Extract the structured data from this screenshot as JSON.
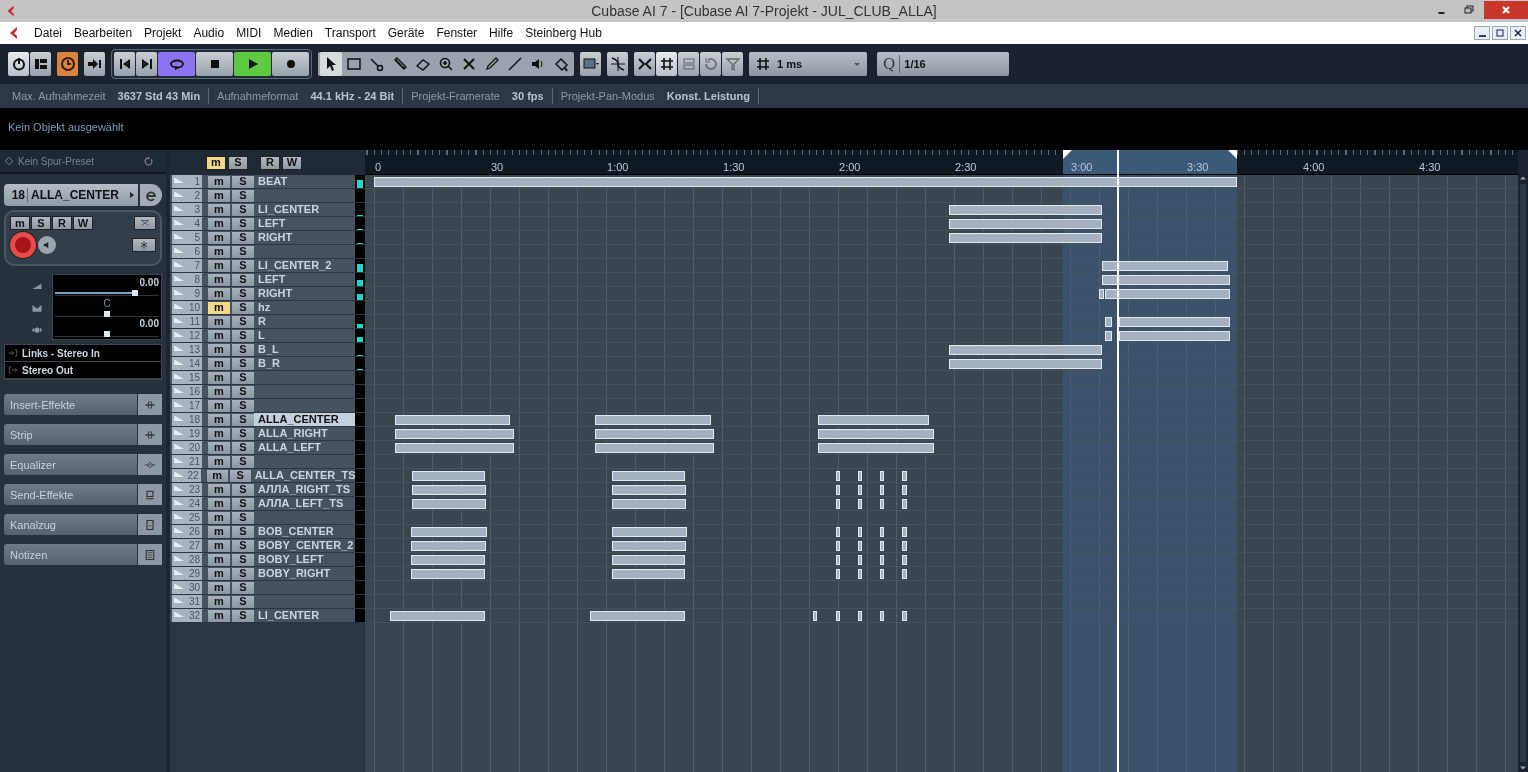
{
  "window": {
    "title": "Cubase AI 7 - [Cubase AI 7-Projekt - JUL_CLUB_ALLA]"
  },
  "menu": [
    "Datei",
    "Bearbeiten",
    "Projekt",
    "Audio",
    "MIDI",
    "Medien",
    "Transport",
    "Geräte",
    "Fenster",
    "Hilfe",
    "Steinberg Hub"
  ],
  "toolbar": {
    "groups": [
      {
        "kind": "plain",
        "items": [
          {
            "kind": "power",
            "on": true
          },
          {
            "kind": "layout",
            "on": false
          }
        ]
      },
      {
        "kind": "plain",
        "items": [
          {
            "kind": "constrain",
            "on": true
          }
        ]
      },
      {
        "kind": "plain",
        "items": [
          {
            "kind": "automation",
            "on": false
          }
        ]
      },
      {
        "kind": "transport",
        "items": [
          {
            "kind": "prev",
            "on": false
          },
          {
            "kind": "next",
            "on": false
          },
          {
            "kind": "cycle",
            "on": true
          },
          {
            "kind": "stop",
            "on": false
          },
          {
            "kind": "play",
            "on": true
          },
          {
            "kind": "record",
            "on": false
          }
        ]
      },
      {
        "kind": "tools",
        "items": [
          {
            "kind": "arrow",
            "selected": true
          },
          {
            "kind": "range",
            "selected": false
          },
          {
            "kind": "split",
            "selected": false
          },
          {
            "kind": "glue",
            "selected": false
          },
          {
            "kind": "erase",
            "selected": false
          },
          {
            "kind": "zoom",
            "selected": false
          },
          {
            "kind": "mute",
            "selected": false
          },
          {
            "kind": "draw",
            "selected": false
          },
          {
            "kind": "line",
            "selected": false
          },
          {
            "kind": "speaker",
            "selected": false
          },
          {
            "kind": "colorize",
            "selected": false
          }
        ]
      },
      {
        "kind": "plain",
        "items": [
          {
            "kind": "color",
            "on": false
          }
        ]
      },
      {
        "kind": "plain",
        "items": [
          {
            "kind": "snapzero",
            "on": false
          }
        ]
      },
      {
        "kind": "plain",
        "items": [
          {
            "kind": "snaptype",
            "on": false
          },
          {
            "kind": "grid",
            "on": true
          },
          {
            "kind": "lanes",
            "on": false
          },
          {
            "kind": "loop",
            "on": false
          },
          {
            "kind": "funnel",
            "on": false
          }
        ]
      }
    ],
    "grid_value": "1 ms",
    "quantize_label": "Q",
    "quantize_value": "1/16"
  },
  "info_line": [
    {
      "label": "Max. Aufnahmezeit",
      "value": "3637 Std 43 Min"
    },
    {
      "label": "Aufnahmeformat",
      "value": "44.1 kHz - 24 Bit"
    },
    {
      "label": "Projekt-Framerate",
      "value": "30 fps"
    },
    {
      "label": "Projekt-Pan-Modus",
      "value": "Konst. Leistung"
    }
  ],
  "selection_info": "Kein Objekt ausgewählt",
  "inspector": {
    "preset": "Kein Spur-Preset",
    "track_number": "18",
    "track_name": "ALLA_CENTER",
    "buttons": [
      {
        "label": "m",
        "on": false
      },
      {
        "label": "S",
        "on": false
      },
      {
        "label": "R",
        "on": false
      },
      {
        "label": "W",
        "on": false
      }
    ],
    "record_enabled": true,
    "monitor": false,
    "volume": {
      "level": 0.77,
      "reading": "0.00"
    },
    "pan": {
      "level": 0.5,
      "reading": "C"
    },
    "delay": {
      "level": 0.5,
      "reading": "0.00"
    },
    "input": "Links - Stereo In",
    "output": "Stereo Out",
    "sections": [
      {
        "label": "Insert-Effekte",
        "kind": "insert"
      },
      {
        "label": "Strip",
        "kind": "strip"
      },
      {
        "label": "Equalizer",
        "kind": "eq"
      },
      {
        "label": "Send-Effekte",
        "kind": "send"
      },
      {
        "label": "Kanalzug",
        "kind": "channel"
      },
      {
        "label": "Notizen",
        "kind": "notes"
      }
    ]
  },
  "track_header": [
    {
      "label": "m",
      "on": true
    },
    {
      "label": "S",
      "on": false
    },
    {
      "label": "R",
      "on": false
    },
    {
      "label": "W",
      "on": false
    }
  ],
  "ruler": [
    "0",
    "30",
    "1:00",
    "1:30",
    "2:00",
    "2:30",
    "3:00",
    "3:30",
    "4:00",
    "4:30"
  ],
  "tracks": [
    {
      "number": "1",
      "mute": "m",
      "solo": "S",
      "name": "BEAT",
      "muted": false,
      "selected": false,
      "level": 0.6,
      "events": [
        {
          "kind": "audio"
        }
      ]
    },
    {
      "number": "2",
      "mute": "m",
      "solo": "S",
      "muted": false,
      "selected": false
    },
    {
      "number": "3",
      "mute": "m",
      "solo": "S",
      "name": "LI_CENTER",
      "muted": false,
      "selected": false,
      "level": 0.1,
      "events": [
        {
          "kind": "audio"
        }
      ]
    },
    {
      "number": "4",
      "mute": "m",
      "solo": "S",
      "name": "LEFT",
      "muted": false,
      "selected": false,
      "level": 0.1,
      "events": [
        {
          "kind": "audio"
        }
      ]
    },
    {
      "number": "5",
      "mute": "m",
      "solo": "S",
      "name": "RIGHT",
      "muted": false,
      "selected": false,
      "level": 0.1,
      "events": [
        {
          "kind": "audio"
        }
      ]
    },
    {
      "number": "6",
      "mute": "m",
      "solo": "S",
      "muted": false,
      "selected": false
    },
    {
      "number": "7",
      "mute": "m",
      "solo": "S",
      "name": "LI_CENTER_2",
      "muted": false,
      "selected": false,
      "level": 0.6,
      "events": [
        {
          "kind": "audio"
        }
      ]
    },
    {
      "number": "8",
      "mute": "m",
      "solo": "S",
      "name": "LEFT",
      "muted": false,
      "selected": false,
      "level": 0.5,
      "events": [
        {
          "kind": "audio"
        }
      ]
    },
    {
      "number": "9",
      "mute": "m",
      "solo": "S",
      "name": "RIGHT",
      "muted": false,
      "selected": false,
      "level": 0.5,
      "events": [
        {
          "kind": "audio"
        },
        {
          "kind": "audio"
        }
      ]
    },
    {
      "number": "10",
      "mute": "m",
      "solo": "S",
      "name": "hz",
      "muted": true,
      "selected": false
    },
    {
      "number": "11",
      "mute": "m",
      "solo": "S",
      "name": "R",
      "muted": false,
      "selected": false,
      "level": 0.3,
      "events": [
        {
          "kind": "audio"
        },
        {
          "kind": "audio"
        }
      ]
    },
    {
      "number": "12",
      "mute": "m",
      "solo": "S",
      "name": "L",
      "muted": false,
      "selected": false,
      "level": 0.4,
      "events": [
        {
          "kind": "audio"
        },
        {
          "kind": "audio"
        }
      ]
    },
    {
      "number": "13",
      "mute": "m",
      "solo": "S",
      "name": "B_L",
      "muted": false,
      "selected": false,
      "level": 0.05,
      "events": [
        {
          "kind": "audio"
        }
      ]
    },
    {
      "number": "14",
      "mute": "m",
      "solo": "S",
      "name": "B_R",
      "muted": false,
      "selected": false,
      "level": 0.05,
      "events": [
        {
          "kind": "audio"
        }
      ]
    },
    {
      "number": "15",
      "mute": "m",
      "solo": "S",
      "muted": false,
      "selected": false
    },
    {
      "number": "16",
      "mute": "m",
      "solo": "S",
      "muted": false,
      "selected": false
    },
    {
      "number": "17",
      "mute": "m",
      "solo": "S",
      "muted": false,
      "selected": false
    },
    {
      "number": "18",
      "mute": "m",
      "solo": "S",
      "name": "ALLA_CENTER",
      "muted": false,
      "selected": true,
      "events": [
        {
          "kind": "audio"
        },
        {
          "kind": "audio"
        },
        {
          "kind": "audio"
        }
      ]
    },
    {
      "number": "19",
      "mute": "m",
      "solo": "S",
      "name": "ALLA_RIGHT",
      "muted": false,
      "selected": false,
      "events": [
        {
          "kind": "audio"
        },
        {
          "kind": "audio"
        },
        {
          "kind": "audio"
        }
      ]
    },
    {
      "number": "20",
      "mute": "m",
      "solo": "S",
      "name": "ALLA_LEFT",
      "muted": false,
      "selected": false,
      "events": [
        {
          "kind": "audio"
        },
        {
          "kind": "audio"
        },
        {
          "kind": "audio"
        }
      ]
    },
    {
      "number": "21",
      "mute": "m",
      "solo": "S",
      "muted": false,
      "selected": false
    },
    {
      "number": "22",
      "mute": "m",
      "solo": "S",
      "name": "ALLA_CENTER_TS",
      "muted": false,
      "selected": false,
      "events": [
        {
          "kind": "audio"
        },
        {
          "kind": "audio"
        },
        {
          "kind": "audio"
        },
        {
          "kind": "audio"
        },
        {
          "kind": "audio"
        },
        {
          "kind": "audio"
        }
      ]
    },
    {
      "number": "23",
      "mute": "m",
      "solo": "S",
      "name": "АЛЛА_RIGHT_TS",
      "muted": false,
      "selected": false,
      "events": [
        {
          "kind": "audio"
        },
        {
          "kind": "audio"
        },
        {
          "kind": "audio"
        },
        {
          "kind": "audio"
        },
        {
          "kind": "audio"
        },
        {
          "kind": "audio"
        }
      ]
    },
    {
      "number": "24",
      "mute": "m",
      "solo": "S",
      "name": "АЛЛА_LEFT_TS",
      "muted": false,
      "selected": false,
      "events": [
        {
          "kind": "audio"
        },
        {
          "kind": "audio"
        },
        {
          "kind": "audio"
        },
        {
          "kind": "audio"
        },
        {
          "kind": "audio"
        },
        {
          "kind": "audio"
        }
      ]
    },
    {
      "number": "25",
      "mute": "m",
      "solo": "S",
      "muted": false,
      "selected": false
    },
    {
      "number": "26",
      "mute": "m",
      "solo": "S",
      "name": "BOB_CENTER",
      "muted": false,
      "selected": false,
      "events": [
        {
          "kind": "audio"
        },
        {
          "kind": "audio"
        },
        {
          "kind": "audio"
        },
        {
          "kind": "audio"
        },
        {
          "kind": "audio"
        },
        {
          "kind": "audio"
        }
      ]
    },
    {
      "number": "27",
      "mute": "m",
      "solo": "S",
      "name": "BOBY_CENTER_2",
      "muted": false,
      "selected": false,
      "events": [
        {
          "kind": "audio"
        },
        {
          "kind": "audio"
        },
        {
          "kind": "audio"
        },
        {
          "kind": "audio"
        },
        {
          "kind": "audio"
        },
        {
          "kind": "audio"
        }
      ]
    },
    {
      "number": "28",
      "mute": "m",
      "solo": "S",
      "name": "BOBY_LEFT",
      "muted": false,
      "selected": false,
      "events": [
        {
          "kind": "audio"
        },
        {
          "kind": "audio"
        },
        {
          "kind": "audio"
        },
        {
          "kind": "audio"
        },
        {
          "kind": "audio"
        },
        {
          "kind": "audio"
        }
      ]
    },
    {
      "number": "29",
      "mute": "m",
      "solo": "S",
      "name": "BOBY_RIGHT",
      "muted": false,
      "selected": false,
      "events": [
        {
          "kind": "audio"
        },
        {
          "kind": "audio"
        },
        {
          "kind": "audio"
        },
        {
          "kind": "audio"
        },
        {
          "kind": "audio"
        },
        {
          "kind": "audio"
        }
      ]
    },
    {
      "number": "30",
      "mute": "m",
      "solo": "S",
      "muted": false,
      "selected": false
    },
    {
      "number": "31",
      "mute": "m",
      "solo": "S",
      "muted": false,
      "selected": false
    },
    {
      "number": "32",
      "mute": "m",
      "solo": "S",
      "name": "LI_CENTER",
      "muted": false,
      "selected": false,
      "events": [
        {
          "kind": "audio"
        },
        {
          "kind": "audio"
        },
        {
          "kind": "audio"
        },
        {
          "kind": "audio"
        },
        {
          "kind": "audio"
        },
        {
          "kind": "audio"
        },
        {
          "kind": "audio"
        }
      ]
    }
  ]
}
